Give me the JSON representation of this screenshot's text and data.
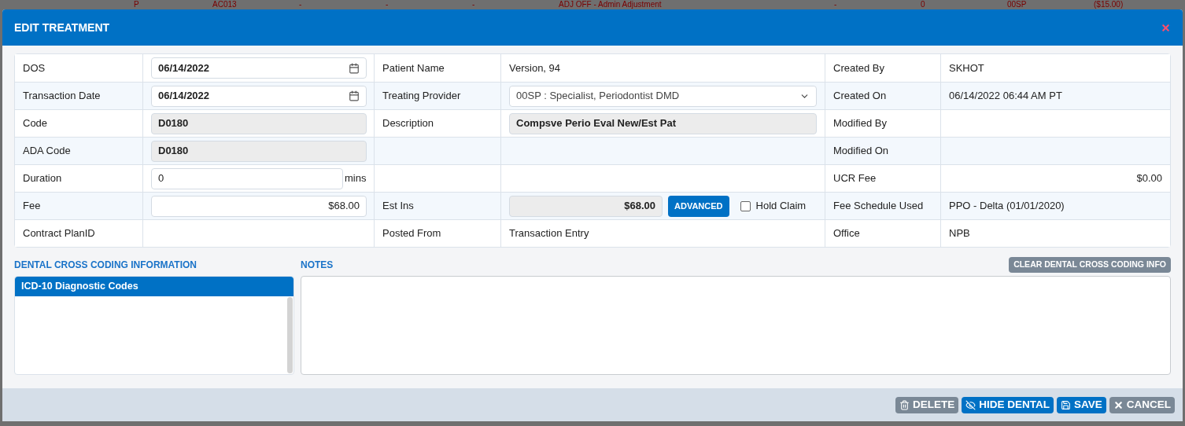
{
  "backdrop_row": [
    "P",
    "AC013",
    "-",
    "-",
    "-",
    "ADJ OFF - Admin Adjustment",
    "-",
    "0",
    "00SP",
    "($15.00)"
  ],
  "window": {
    "title": "EDIT TREATMENT"
  },
  "form": {
    "rows": [
      [
        {
          "label": "DOS",
          "kind": "date",
          "value": "06/14/2022"
        },
        {
          "label": "Patient Name",
          "kind": "text",
          "value": "Version, 94"
        },
        {
          "label": "Created By",
          "kind": "text",
          "value": "SKHOT"
        }
      ],
      [
        {
          "label": "Transaction Date",
          "kind": "date",
          "value": "06/14/2022"
        },
        {
          "label": "Treating Provider",
          "kind": "select",
          "value": "00SP : Specialist, Periodontist DMD"
        },
        {
          "label": "Created On",
          "kind": "text",
          "value": "06/14/2022 06:44 AM PT"
        }
      ],
      [
        {
          "label": "Code",
          "kind": "readonly",
          "value": "D0180"
        },
        {
          "label": "Description",
          "kind": "readonly",
          "value": "Compsve Perio Eval New/Est Pat"
        },
        {
          "label": "Modified By",
          "kind": "empty"
        }
      ],
      [
        {
          "label": "ADA Code",
          "kind": "readonly",
          "value": "D0180"
        },
        {
          "kind": "empty"
        },
        {
          "label": "Modified On",
          "kind": "empty"
        }
      ],
      [
        {
          "label": "Duration",
          "kind": "unit_input",
          "value": "0",
          "unit": "mins"
        },
        {
          "kind": "empty"
        },
        {
          "label": "UCR Fee",
          "kind": "amount",
          "value": "$0.00"
        }
      ],
      [
        {
          "label": "Fee",
          "kind": "money_input",
          "value": "$68.00"
        },
        {
          "label": "Est Ins",
          "kind": "est_ins",
          "value": "$68.00",
          "button": "ADVANCED",
          "checkbox": {
            "label": "Hold Claim",
            "checked": false
          }
        },
        {
          "label": "Fee Schedule Used",
          "kind": "text",
          "value": "PPO - Delta (01/01/2020)"
        }
      ],
      [
        {
          "label": "Contract PlanID",
          "kind": "empty"
        },
        {
          "label": "Posted From",
          "kind": "text",
          "value": "Transaction Entry"
        },
        {
          "label": "Office",
          "kind": "text",
          "value": "NPB"
        }
      ]
    ]
  },
  "cross_coding": {
    "title": "DENTAL CROSS CODING INFORMATION",
    "list_header": "ICD-10 Diagnostic Codes"
  },
  "notes": {
    "title": "NOTES",
    "clear_button": "CLEAR DENTAL CROSS CODING INFO"
  },
  "footer_buttons": [
    {
      "kind": "delete",
      "label": "DELETE"
    },
    {
      "kind": "hide",
      "label": "HIDE DENTAL"
    },
    {
      "kind": "save",
      "label": "SAVE"
    },
    {
      "kind": "cancel",
      "label": "CANCEL"
    }
  ]
}
